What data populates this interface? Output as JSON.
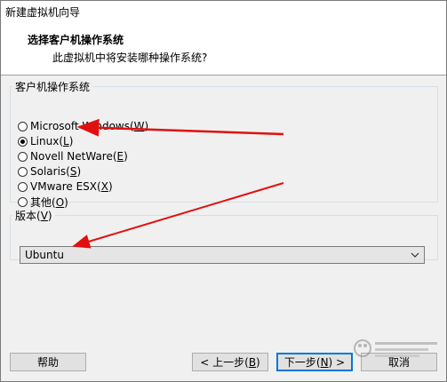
{
  "window": {
    "title": "新建虚拟机向导"
  },
  "header": {
    "title": "选择客户机操作系统",
    "subtitle": "此虚拟机中将安装哪种操作系统?"
  },
  "os_group": {
    "legend": "客户机操作系统",
    "options": [
      {
        "label": "Microsoft Windows(",
        "accel": "W",
        "end": ")",
        "checked": false
      },
      {
        "label": "Linux(",
        "accel": "L",
        "end": ")",
        "checked": true
      },
      {
        "label": "Novell NetWare(",
        "accel": "E",
        "end": ")",
        "checked": false
      },
      {
        "label": "Solaris(",
        "accel": "S",
        "end": ")",
        "checked": false
      },
      {
        "label": "VMware ESX(",
        "accel": "X",
        "end": ")",
        "checked": false
      },
      {
        "label": "其他(",
        "accel": "O",
        "end": ")",
        "checked": false
      }
    ]
  },
  "version_group": {
    "legend_text": "版本(",
    "legend_accel": "V",
    "legend_end": ")",
    "selected": "Ubuntu"
  },
  "buttons": {
    "help": "帮助",
    "back_text": "< 上一步(",
    "back_accel": "B",
    "back_end": ")",
    "next_text": "下一步(",
    "next_accel": "N",
    "next_end": ") >",
    "cancel": "取消"
  },
  "colors": {
    "annotation_arrow": "#e01010",
    "default_button_border": "#0078d7"
  },
  "icons": {
    "dropdown": "chevron-down-icon",
    "annotation": "arrow-icon",
    "watermark": "baidu-jingyan-watermark-icon"
  }
}
